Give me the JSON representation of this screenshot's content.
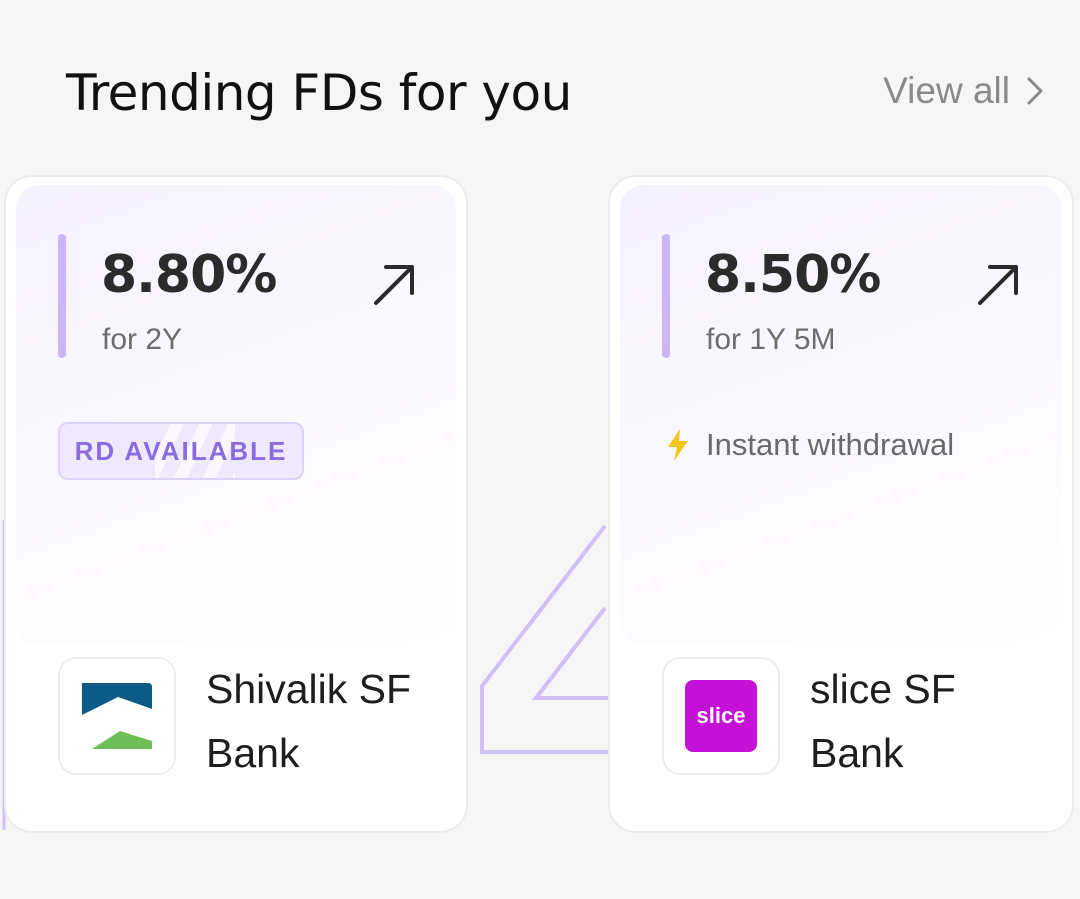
{
  "header": {
    "title": "Trending FDs for you",
    "view_all_label": "View all"
  },
  "cards": [
    {
      "rate": "8.80%",
      "tenure": "for 2Y",
      "tag": "RD AVAILABLE",
      "bank_name": "Shivalik SF Bank",
      "logo_icon": "shivalik-bank-logo"
    },
    {
      "rate": "8.50%",
      "tenure": "for 1Y 5M",
      "feature": "Instant withdrawal",
      "feature_icon": "lightning-icon",
      "bank_name": "slice SF Bank",
      "logo_text": "slice",
      "logo_icon": "slice-bank-logo"
    }
  ],
  "colors": {
    "accent_purple": "#c9b6f7",
    "badge_text": "#8a6ce0",
    "slice_magenta": "#c510d8",
    "shivalik_blue": "#0c5a87",
    "shivalik_green": "#6fbf58",
    "lightning_yellow": "#f5c518"
  }
}
